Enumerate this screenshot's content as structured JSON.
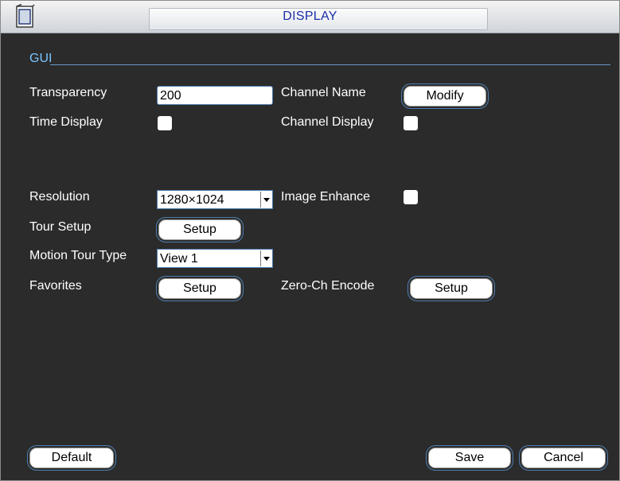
{
  "window": {
    "title": "DISPLAY"
  },
  "gui": {
    "section_label": "GUI",
    "transparency": {
      "label": "Transparency",
      "value": "200"
    },
    "channel_name": {
      "label": "Channel Name",
      "button": "Modify"
    },
    "time_display": {
      "label": "Time Display",
      "checked": false
    },
    "channel_display": {
      "label": "Channel Display",
      "checked": false
    },
    "resolution": {
      "label": "Resolution",
      "value": "1280×1024"
    },
    "image_enhance": {
      "label": "Image Enhance",
      "checked": false
    },
    "tour_setup": {
      "label": "Tour Setup",
      "button": "Setup"
    },
    "motion_tour_type": {
      "label": "Motion Tour Type",
      "value": "View 1"
    },
    "favorites": {
      "label": "Favorites",
      "button": "Setup"
    },
    "zero_ch_encode": {
      "label": "Zero-Ch Encode",
      "button": "Setup"
    }
  },
  "footer": {
    "default_label": "Default",
    "save_label": "Save",
    "cancel_label": "Cancel"
  },
  "colors": {
    "background": "#2b2b2b",
    "section_label": "#7ac4ff",
    "title_text": "#1a2fa8",
    "accent_border": "#4f7fb1"
  },
  "icons": {
    "title_icon": "window-frame-icon"
  }
}
